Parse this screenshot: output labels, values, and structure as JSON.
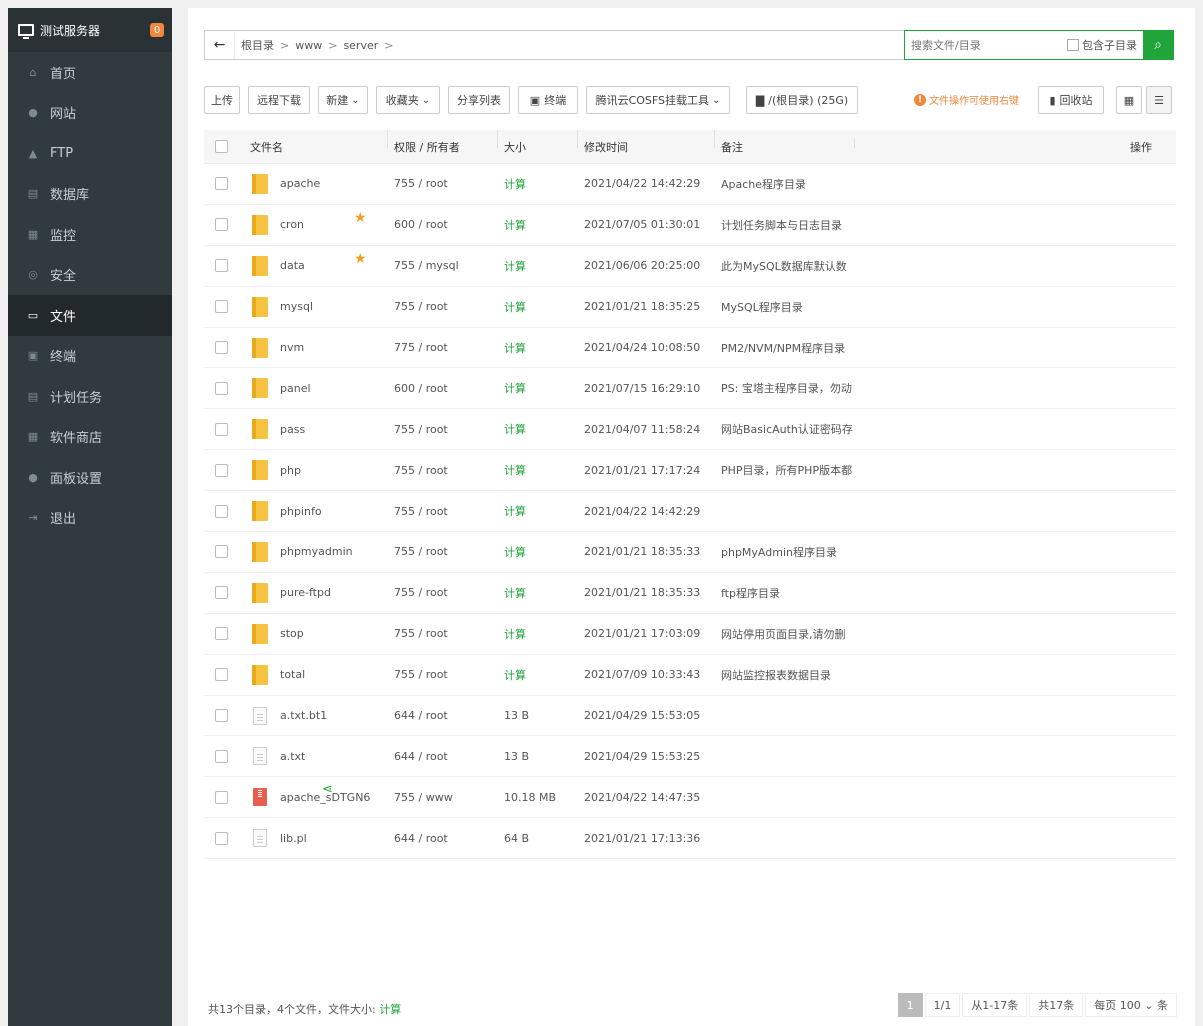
{
  "sidebar": {
    "server_name": "测试服务器",
    "badge": "0",
    "items": [
      {
        "label": "首页",
        "icon": "home-icon",
        "glyph": "⌂"
      },
      {
        "label": "网站",
        "icon": "globe-icon",
        "glyph": "●"
      },
      {
        "label": "FTP",
        "icon": "ftp-icon",
        "glyph": "▲"
      },
      {
        "label": "数据库",
        "icon": "database-icon",
        "glyph": "▤"
      },
      {
        "label": "监控",
        "icon": "monitor-chart-icon",
        "glyph": "▦"
      },
      {
        "label": "安全",
        "icon": "shield-icon",
        "glyph": "◎"
      },
      {
        "label": "文件",
        "icon": "folder-icon",
        "glyph": "▭"
      },
      {
        "label": "终端",
        "icon": "terminal-icon",
        "glyph": "▣"
      },
      {
        "label": "计划任务",
        "icon": "calendar-icon",
        "glyph": "▤"
      },
      {
        "label": "软件商店",
        "icon": "grid-icon",
        "glyph": "▦"
      },
      {
        "label": "面板设置",
        "icon": "gear-icon",
        "glyph": "●"
      },
      {
        "label": "退出",
        "icon": "logout-icon",
        "glyph": "⇥"
      }
    ],
    "active_index": 6
  },
  "path": {
    "back_icon": "arrow-left-icon",
    "crumbs": [
      "根目录",
      "www",
      "server"
    ],
    "sep": ">",
    "refresh_icon": "refresh-icon"
  },
  "search": {
    "placeholder": "搜索文件/目录",
    "include_sub_label": "包含子目录",
    "button_icon": "search-icon"
  },
  "toolbar": {
    "upload": "上传",
    "remote_download": "远程下载",
    "new": "新建",
    "favorites": "收藏夹",
    "share_list": "分享列表",
    "terminal": "终端",
    "cosfs": "腾讯云COSFS挂载工具",
    "disk": "/(根目录) (25G)",
    "tip": "文件操作可使用右键",
    "recycle": "回收站",
    "accent": "#20a53a"
  },
  "table": {
    "headers": {
      "name": "文件名",
      "perm": "权限 / 所有者",
      "size": "大小",
      "mtime": "修改时间",
      "note": "备注",
      "ops": "操作"
    },
    "rows": [
      {
        "type": "folder",
        "name": "apache",
        "perm": "755 / root",
        "size": "计算",
        "mtime": "2021/04/22 14:42:29",
        "note": "Apache程序目录",
        "star": false
      },
      {
        "type": "folder",
        "name": "cron",
        "perm": "600 / root",
        "size": "计算",
        "mtime": "2021/07/05 01:30:01",
        "note": "计划任务脚本与日志目录",
        "star": true
      },
      {
        "type": "folder",
        "name": "data",
        "perm": "755 / mysql",
        "size": "计算",
        "mtime": "2021/06/06 20:25:00",
        "note": "此为MySQL数据库默认数",
        "star": true
      },
      {
        "type": "folder",
        "name": "mysql",
        "perm": "755 / root",
        "size": "计算",
        "mtime": "2021/01/21 18:35:25",
        "note": "MySQL程序目录",
        "star": false
      },
      {
        "type": "folder",
        "name": "nvm",
        "perm": "775 / root",
        "size": "计算",
        "mtime": "2021/04/24 10:08:50",
        "note": "PM2/NVM/NPM程序目录",
        "star": false
      },
      {
        "type": "folder",
        "name": "panel",
        "perm": "600 / root",
        "size": "计算",
        "mtime": "2021/07/15 16:29:10",
        "note": "PS: 宝塔主程序目录，勿动",
        "star": false
      },
      {
        "type": "folder",
        "name": "pass",
        "perm": "755 / root",
        "size": "计算",
        "mtime": "2021/04/07 11:58:24",
        "note": "网站BasicAuth认证密码存",
        "star": false
      },
      {
        "type": "folder",
        "name": "php",
        "perm": "755 / root",
        "size": "计算",
        "mtime": "2021/01/21 17:17:24",
        "note": "PHP目录，所有PHP版本都",
        "star": false
      },
      {
        "type": "folder",
        "name": "phpinfo",
        "perm": "755 / root",
        "size": "计算",
        "mtime": "2021/04/22 14:42:29",
        "note": "",
        "star": false
      },
      {
        "type": "folder",
        "name": "phpmyadmin",
        "perm": "755 / root",
        "size": "计算",
        "mtime": "2021/01/21 18:35:33",
        "note": "phpMyAdmin程序目录",
        "star": false
      },
      {
        "type": "folder",
        "name": "pure-ftpd",
        "perm": "755 / root",
        "size": "计算",
        "mtime": "2021/01/21 18:35:33",
        "note": "ftp程序目录",
        "star": false
      },
      {
        "type": "folder",
        "name": "stop",
        "perm": "755 / root",
        "size": "计算",
        "mtime": "2021/01/21 17:03:09",
        "note": "网站停用页面目录,请勿删",
        "star": false
      },
      {
        "type": "folder",
        "name": "total",
        "perm": "755 / root",
        "size": "计算",
        "mtime": "2021/07/09 10:33:43",
        "note": "网站监控报表数据目录",
        "star": false
      },
      {
        "type": "file",
        "name": "a.txt.bt1",
        "perm": "644 / root",
        "size": "13 B",
        "mtime": "2021/04/29 15:53:05",
        "note": "",
        "star": false
      },
      {
        "type": "file",
        "name": "a.txt",
        "perm": "644 / root",
        "size": "13 B",
        "mtime": "2021/04/29 15:53:25",
        "note": "",
        "star": false
      },
      {
        "type": "archive",
        "name": "apache_sDTGN6",
        "perm": "755 / www",
        "size": "10.18 MB",
        "mtime": "2021/04/22 14:47:35",
        "note": "",
        "star": false,
        "shared": true
      },
      {
        "type": "file",
        "name": "lib.pl",
        "perm": "644 / root",
        "size": "64 B",
        "mtime": "2021/01/21 17:13:36",
        "note": "",
        "star": false
      }
    ]
  },
  "footer": {
    "summary": "共13个目录，4个文件，文件大小:",
    "calc": "计算",
    "page_current": "1",
    "page_of": "1/1",
    "range": "从1-17条",
    "total": "共17条",
    "per_page_label": "每页",
    "per_page": "100",
    "unit": "条"
  }
}
